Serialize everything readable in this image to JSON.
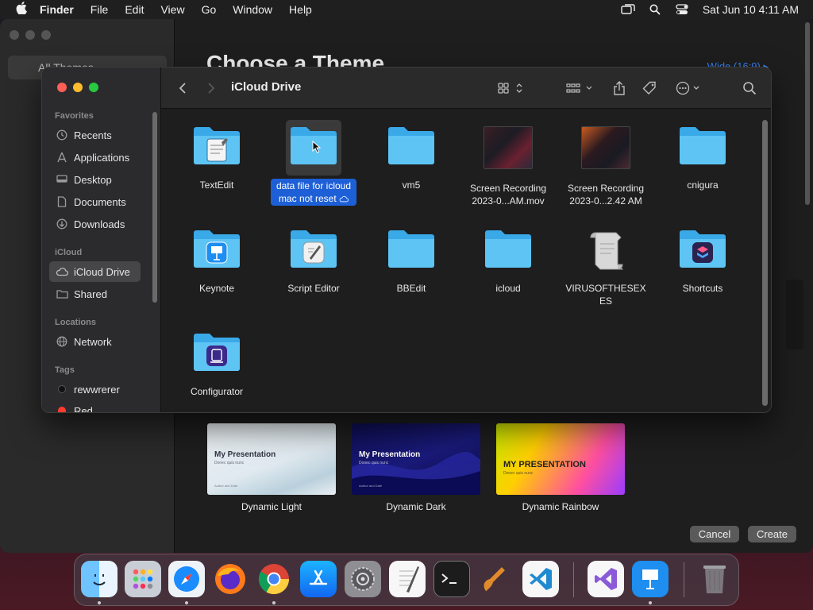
{
  "menubar": {
    "app_name": "Finder",
    "menus": [
      "File",
      "Edit",
      "View",
      "Go",
      "Window",
      "Help"
    ],
    "clock": "Sat Jun 10  4:11 AM"
  },
  "keynote": {
    "sidebar_item": "All Themes",
    "title": "Choose a Theme",
    "size_selector": "Wide (16:9) ▸",
    "themes": [
      {
        "label": "Dynamic Light",
        "thumb_title": "My Presentation",
        "thumb_sub": "Donec quis nunc",
        "thumb_foot": "Author and Date"
      },
      {
        "label": "Dynamic Dark",
        "thumb_title": "My Presentation",
        "thumb_sub": "Donec quis nunc",
        "thumb_foot": "Author and Date"
      },
      {
        "label": "Dynamic Rainbow",
        "thumb_title": "MY PRESENTATION",
        "thumb_sub": "Donec quis nunc",
        "thumb_foot": ""
      }
    ],
    "cancel_label": "Cancel",
    "create_label": "Create"
  },
  "finder": {
    "title": "iCloud Drive",
    "sidebar": {
      "favorites_header": "Favorites",
      "favorites": [
        {
          "label": "Recents",
          "icon": "clock-icon"
        },
        {
          "label": "Applications",
          "icon": "applications-icon"
        },
        {
          "label": "Desktop",
          "icon": "desktop-icon"
        },
        {
          "label": "Documents",
          "icon": "document-icon"
        },
        {
          "label": "Downloads",
          "icon": "downloads-icon"
        }
      ],
      "icloud_header": "iCloud",
      "icloud": [
        {
          "label": "iCloud Drive",
          "icon": "cloud-icon",
          "selected": true
        },
        {
          "label": "Shared",
          "icon": "shared-folder-icon"
        }
      ],
      "locations_header": "Locations",
      "locations": [
        {
          "label": "Network",
          "icon": "globe-icon"
        }
      ],
      "tags_header": "Tags",
      "tags": [
        {
          "label": "rewwrerer",
          "color": "#111111"
        },
        {
          "label": "Red",
          "color": "#ff3b30"
        }
      ]
    },
    "items": [
      {
        "label": "TextEdit",
        "type": "folder-app",
        "app": "textedit"
      },
      {
        "label": "data file for icloud mac not reset",
        "type": "folder",
        "selected": true
      },
      {
        "label": "vm5",
        "type": "folder"
      },
      {
        "label": "Screen Recording 2023-0...AM.mov",
        "type": "video"
      },
      {
        "label": "Screen Recording 2023-0...2.42 AM",
        "type": "video"
      },
      {
        "label": "cnigura",
        "type": "folder"
      },
      {
        "label": "Keynote",
        "type": "folder-app",
        "app": "keynote"
      },
      {
        "label": "Script Editor",
        "type": "folder-app",
        "app": "script"
      },
      {
        "label": "BBEdit",
        "type": "folder"
      },
      {
        "label": "icloud",
        "type": "folder"
      },
      {
        "label": "VIRUSOFTHESEXES",
        "type": "scroll-doc"
      },
      {
        "label": "Shortcuts",
        "type": "folder-app",
        "app": "shortcuts"
      },
      {
        "label": "Configurator",
        "type": "folder-app",
        "app": "configurator"
      }
    ]
  },
  "dock": {
    "apps": [
      "Finder",
      "Launchpad",
      "Safari",
      "Firefox",
      "Chrome",
      "App Store",
      "System Settings",
      "TextEdit",
      "Terminal",
      "GarageBand",
      "VS Code",
      "Visual Studio",
      "Keynote",
      "Trash"
    ]
  },
  "colors": {
    "folder_blue": "#4fc3f7",
    "selection_blue": "#1d5fd6",
    "accent": "#3b82f6"
  }
}
